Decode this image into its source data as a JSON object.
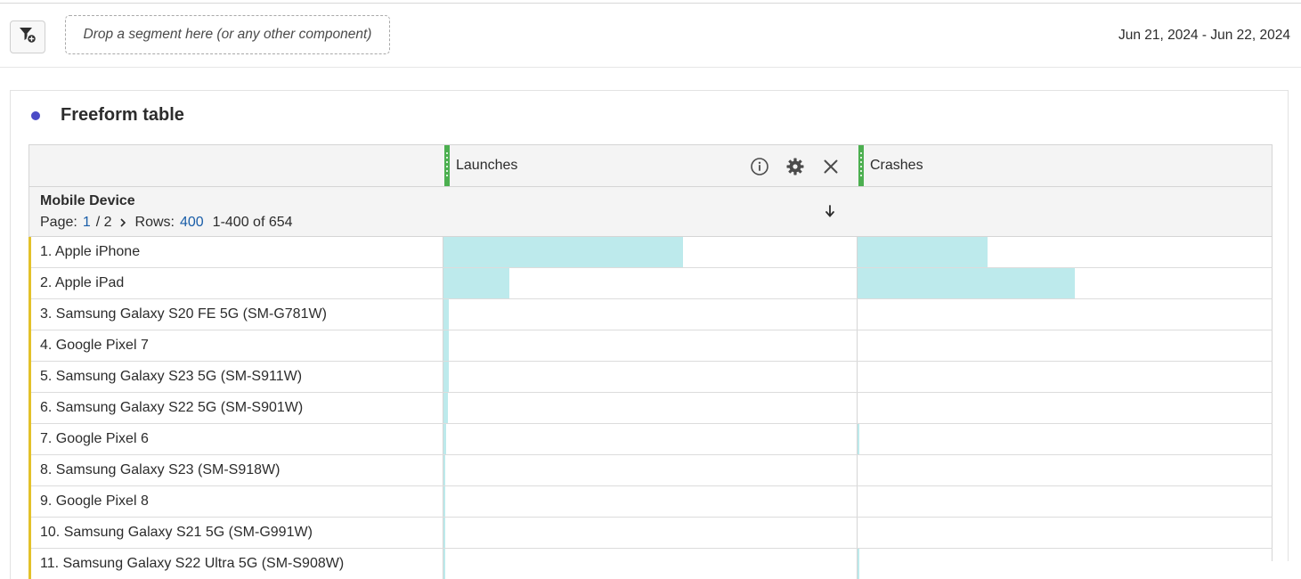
{
  "toolbar": {
    "filter_icon": "filter-add-icon",
    "drop_zone_text": "Drop a segment here (or any other component)",
    "date_range": "Jun 21, 2024 - Jun 22, 2024"
  },
  "panel": {
    "title": "Freeform table",
    "accent_color": "#4b4bc6"
  },
  "table": {
    "columns": [
      {
        "label": "Launches",
        "icons": [
          "info-icon",
          "gear-icon",
          "close-icon"
        ]
      },
      {
        "label": "Crashes"
      }
    ],
    "dimension": {
      "title": "Mobile Device",
      "page_label": "Page:",
      "page_current": "1",
      "page_total": "/ 2",
      "rows_label": "Rows:",
      "rows_value": "400",
      "range_text": "1-400 of 654"
    },
    "bar_color": "#bdeaec",
    "row_accent_color": "#e3c12a",
    "rows": [
      {
        "label": "1.  Apple iPhone",
        "launches_pct": 0.58,
        "crashes_pct": 0.315
      },
      {
        "label": "2.  Apple iPad",
        "launches_pct": 0.16,
        "crashes_pct": 0.525
      },
      {
        "label": "3.  Samsung Galaxy S20 FE 5G (SM-G781W)",
        "launches_pct": 0.012,
        "crashes_pct": 0
      },
      {
        "label": "4.  Google Pixel 7",
        "launches_pct": 0.012,
        "crashes_pct": 0
      },
      {
        "label": "5.  Samsung Galaxy S23 5G (SM-S911W)",
        "launches_pct": 0.012,
        "crashes_pct": 0
      },
      {
        "label": "6.  Samsung Galaxy S22 5G (SM-S901W)",
        "launches_pct": 0.011,
        "crashes_pct": 0
      },
      {
        "label": "7.  Google Pixel 6",
        "launches_pct": 0.006,
        "crashes_pct": 0.004
      },
      {
        "label": "8.  Samsung Galaxy S23 (SM-S918W)",
        "launches_pct": 0.005,
        "crashes_pct": 0
      },
      {
        "label": "9.  Google Pixel 8",
        "launches_pct": 0.005,
        "crashes_pct": 0
      },
      {
        "label": "10.  Samsung Galaxy S21 5G (SM-G991W)",
        "launches_pct": 0.004,
        "crashes_pct": 0
      },
      {
        "label": "11.  Samsung Galaxy S22 Ultra 5G (SM-S908W)",
        "launches_pct": 0.004,
        "crashes_pct": 0.004
      }
    ]
  }
}
